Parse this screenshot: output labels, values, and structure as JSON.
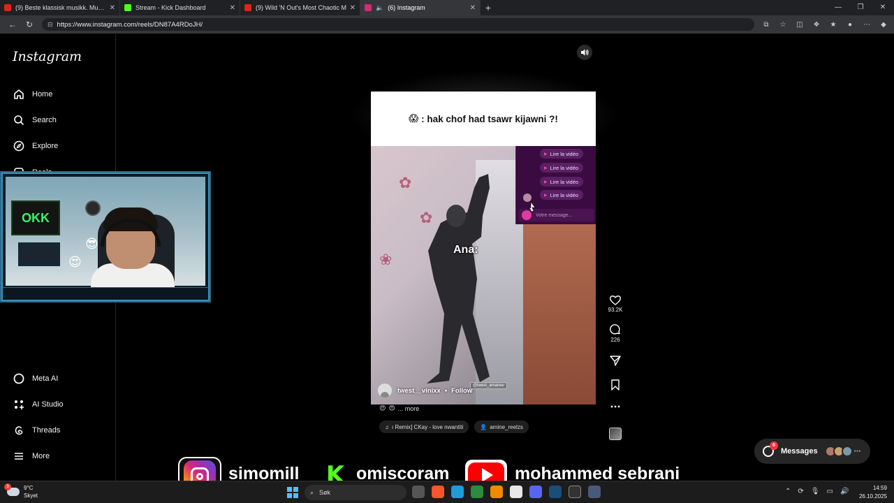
{
  "browser": {
    "tabs": [
      {
        "title": "(9) Beste klassisk musikk. Musikk",
        "favicon_color": "#e62117",
        "active": false
      },
      {
        "title": "Stream - Kick Dashboard",
        "favicon_color": "#53fc18",
        "active": false
      },
      {
        "title": "(9) Wild 'N Out's Most Chaotic M",
        "favicon_color": "#e62117",
        "active": false
      },
      {
        "title": "(6) Instagram",
        "favicon_color": "#d62976",
        "active": true
      }
    ],
    "url": "https://www.instagram.com/reels/DN87A4RDoJH/"
  },
  "sidebar": {
    "logo": "Instagram",
    "items": [
      {
        "label": "Home",
        "icon": "home-icon"
      },
      {
        "label": "Search",
        "icon": "search-icon"
      },
      {
        "label": "Explore",
        "icon": "compass-icon"
      },
      {
        "label": "Reels",
        "icon": "reels-icon"
      }
    ],
    "bottom_items": [
      {
        "label": "Meta AI",
        "icon": "meta-ai-icon"
      },
      {
        "label": "AI Studio",
        "icon": "ai-studio-icon"
      },
      {
        "label": "Threads",
        "icon": "threads-icon"
      },
      {
        "label": "More",
        "icon": "menu-icon"
      }
    ]
  },
  "webcam": {
    "poster_text": "OKK"
  },
  "reel": {
    "caption_emoji": "😱",
    "caption": ": hak chof had tsawr kijawni ?!",
    "overlay_label": "Ana:",
    "chat_buttons": [
      "Lire la vidéo",
      "Lire la vidéo",
      "Lire la vidéo",
      "Lire la vidéo"
    ],
    "chat_placeholder": "Votre message...",
    "username": "twest__vinixx",
    "follow_label": "Follow",
    "tag": "@twest_amanev",
    "description_more": "... more",
    "audio_label": "ı Remix]  CKay - love nwantiti",
    "tagged_user": "amine_reelzs",
    "likes": "93.2K",
    "comments": "226"
  },
  "messages": {
    "label": "Messages",
    "unread": "6"
  },
  "stream_banner": {
    "instagram_handle": "simomill",
    "kick_handle": "omiscoram",
    "youtube_handle": "mohammed sebrani",
    "kick_letter": "K"
  },
  "taskbar": {
    "weather_temp": "9°C",
    "weather_desc": "Skyet",
    "weather_badge": "3",
    "search_placeholder": "Søk",
    "time": "14:59",
    "date": "26.10.2025"
  }
}
